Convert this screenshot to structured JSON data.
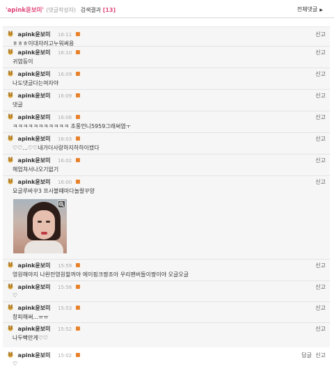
{
  "header": {
    "nickname": "'apink윤보미'",
    "sub": "(댓글작성자)",
    "result_label": "검색결과",
    "count": "[13]",
    "all_comments": "전체댓글",
    "all_arrow": "▶"
  },
  "labels": {
    "report": "신고",
    "reply": "답글"
  },
  "comments": [
    {
      "nick": "apink윤보미",
      "time": "16:11",
      "text": "ㅎㅎㅎ이대자려고누워써용"
    },
    {
      "nick": "apink윤보미",
      "time": "16:10",
      "text": "귀염둥이"
    },
    {
      "nick": "apink윤보미",
      "time": "16:09",
      "text": "나도댓글다는여자야"
    },
    {
      "nick": "apink윤보미",
      "time": "16:09",
      "text": "댓글"
    },
    {
      "nick": "apink윤보미",
      "time": "16:06",
      "text": "ㅋㅋㅋㅋㅋㅋㅋㅋㅋㅋㅋ 초롱언니5959그래써염ㅜ"
    },
    {
      "nick": "apink윤보미",
      "time": "16:03",
      "text": "♡♡...♡♡내가더사랑하지하하이캤다"
    },
    {
      "nick": "apink윤보미",
      "time": "16:02",
      "text": "헤엄쳐서나오기없기"
    },
    {
      "nick": "apink윤보미",
      "time": "16:00",
      "text": "요글루바꾸3 프사볼때마다놀랄꾸양"
    },
    {
      "nick": "apink윤보미",
      "time": "15:59",
      "text": "영원해야지 나완전영원할꺼야 에이핑크짱조아 우리팬버들이짱이야 오글오글"
    },
    {
      "nick": "apink윤보미",
      "time": "15:56",
      "text": "♡"
    },
    {
      "nick": "apink윤보미",
      "time": "15:53",
      "text": "창피해써...ㅠㅠ"
    },
    {
      "nick": "apink윤보미",
      "time": "15:52",
      "text": "나두빡만게♡♡"
    },
    {
      "nick": "apink윤보미",
      "time": "15:02",
      "text": "♡"
    }
  ]
}
